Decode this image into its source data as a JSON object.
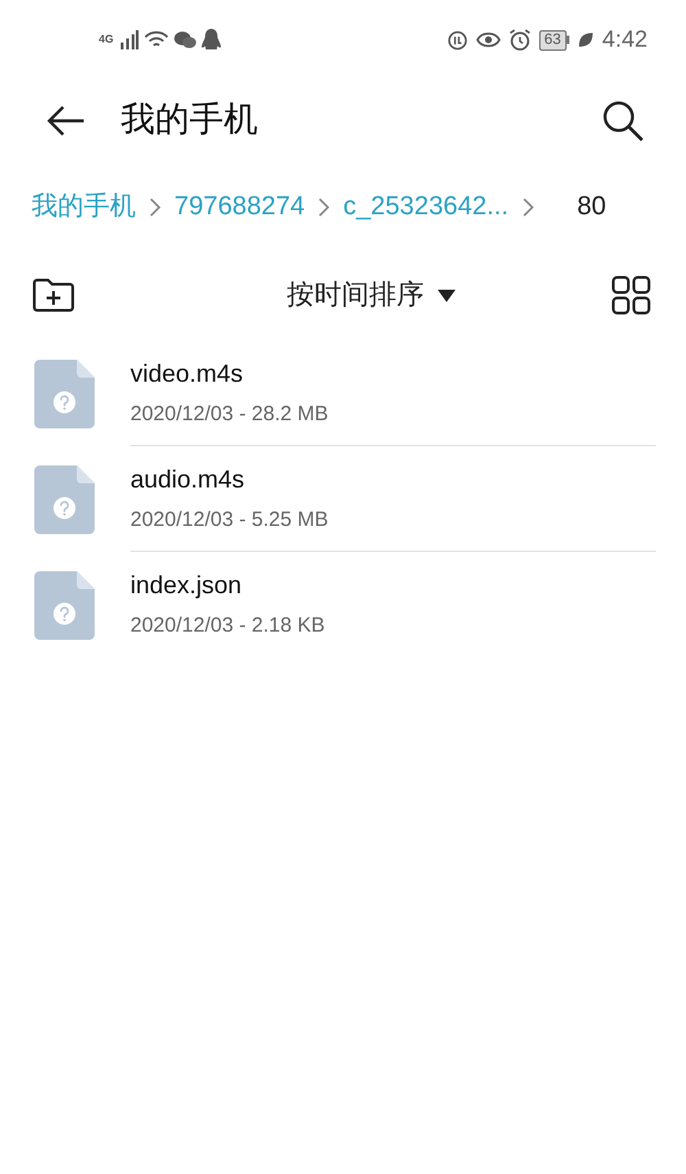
{
  "status_bar": {
    "network": "4G",
    "battery": "63",
    "time": "4:42"
  },
  "header": {
    "title": "我的手机"
  },
  "breadcrumbs": [
    {
      "label": "我的手机",
      "selected": false
    },
    {
      "label": "797688274",
      "selected": false
    },
    {
      "label": "c_25323642...",
      "selected": false
    },
    {
      "label": "80",
      "selected": true
    }
  ],
  "toolbar": {
    "sort_label": "按时间排序"
  },
  "files": [
    {
      "name": "video.m4s",
      "details": "2020/12/03 - 28.2 MB"
    },
    {
      "name": "audio.m4s",
      "details": "2020/12/03 - 5.25 MB"
    },
    {
      "name": "index.json",
      "details": "2020/12/03 - 2.18 KB"
    }
  ]
}
